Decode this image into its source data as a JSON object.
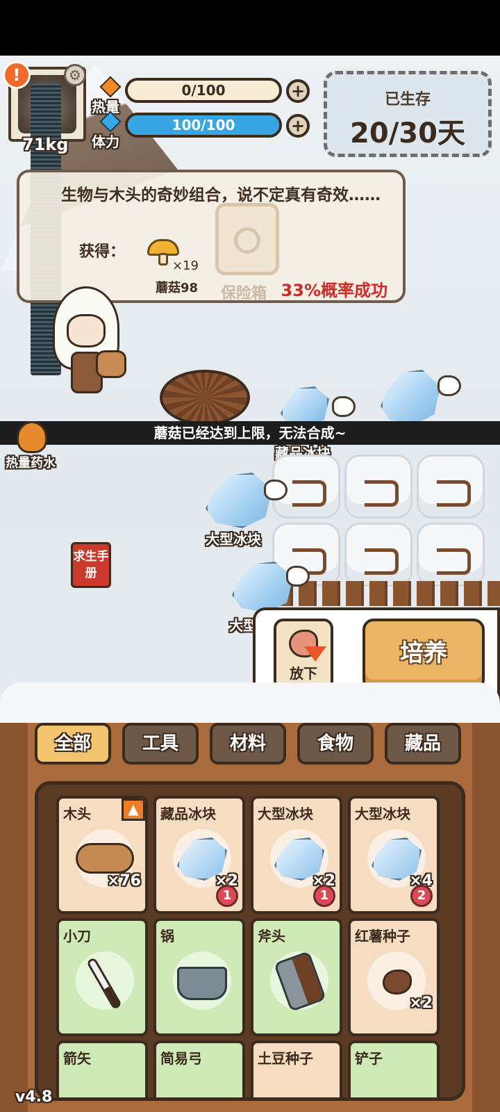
{
  "hud": {
    "weight": "71kg",
    "heat_label": "热量",
    "heat_value": "0/100",
    "heat_fraction": 0.0,
    "stamina_label": "体力",
    "stamina_value": "100/100",
    "stamina_fraction": 1.0,
    "survived_label": "已生存",
    "survived_days": "20/30天"
  },
  "tooltip": {
    "description": "生物与木头的奇妙组合，说不定真有奇效……",
    "gain_label": "获得：",
    "mushroom_count": "×19",
    "mushroom_name": "蘑菇98",
    "safe_name": "保险箱",
    "probability": "33%概率成功"
  },
  "toast": "蘑菇已经达到上限，无法合成~",
  "scene": {
    "heat_potion": "热量药水",
    "collect_ice": "藏品冰块",
    "large_ice": "大型冰块",
    "large_ice_partial": "大型",
    "manual": "求生手册"
  },
  "actions": {
    "drop": "放下",
    "cultivate": "培养"
  },
  "tabs": [
    {
      "label": "全部",
      "active": true
    },
    {
      "label": "工具",
      "active": false
    },
    {
      "label": "材料",
      "active": false
    },
    {
      "label": "食物",
      "active": false
    },
    {
      "label": "藏品",
      "active": false
    }
  ],
  "inventory": [
    {
      "name": "木头",
      "count": "×76",
      "badge": "",
      "theme": "orange",
      "icon": "wood-log-icon"
    },
    {
      "name": "藏品冰块",
      "count": "×2",
      "badge": "1",
      "theme": "orange",
      "icon": "ice-block-icon"
    },
    {
      "name": "大型冰块",
      "count": "×2",
      "badge": "1",
      "theme": "orange",
      "icon": "ice-block-icon"
    },
    {
      "name": "大型冰块",
      "count": "×4",
      "badge": "2",
      "theme": "orange",
      "icon": "ice-block-icon"
    },
    {
      "name": "小刀",
      "count": "",
      "badge": "",
      "theme": "green",
      "icon": "knife-icon"
    },
    {
      "name": "锅",
      "count": "",
      "badge": "",
      "theme": "green",
      "icon": "pot-icon"
    },
    {
      "name": "斧头",
      "count": "",
      "badge": "",
      "theme": "green",
      "icon": "axe-icon"
    },
    {
      "name": "红薯种子",
      "count": "×2",
      "badge": "",
      "theme": "orange",
      "icon": "seed-icon"
    },
    {
      "name": "箭矢",
      "count": "",
      "badge": "",
      "theme": "green",
      "icon": ""
    },
    {
      "name": "简易弓",
      "count": "",
      "badge": "",
      "theme": "green",
      "icon": ""
    },
    {
      "name": "土豆种子",
      "count": "",
      "badge": "",
      "theme": "orange",
      "icon": ""
    },
    {
      "name": "铲子",
      "count": "",
      "badge": "",
      "theme": "green",
      "icon": ""
    }
  ],
  "version": "v4.8",
  "colors": {
    "stamina_bar": "#37a6e3",
    "probability_red": "#cf2a2a",
    "active_tab": "#f2c56e",
    "card_orange": "#f6dcc0",
    "card_green": "#cfeab7"
  }
}
